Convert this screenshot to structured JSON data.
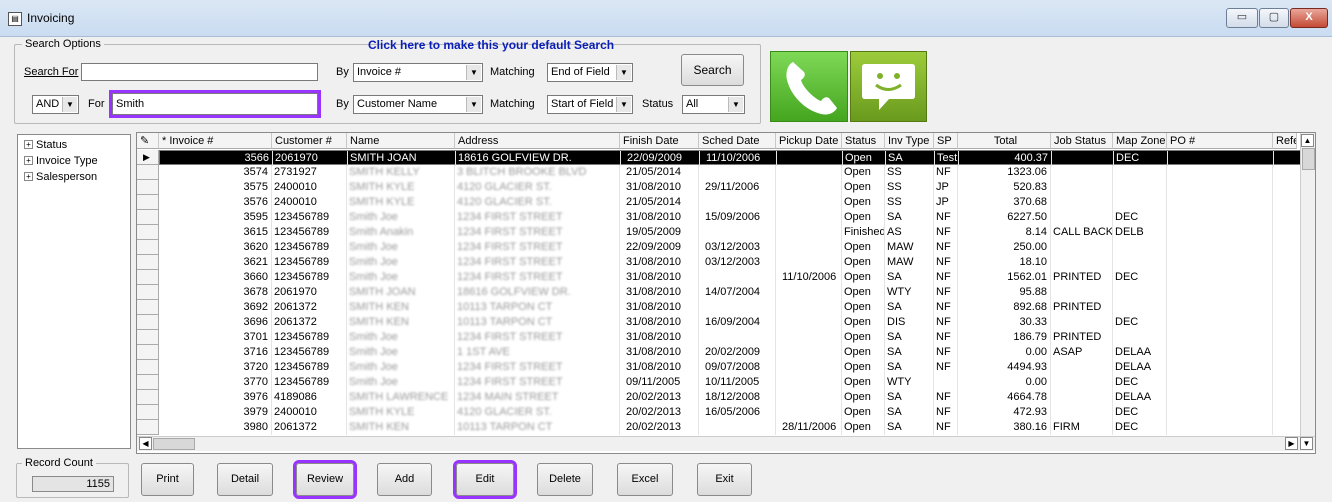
{
  "window": {
    "title": "Invoicing",
    "min": "▭",
    "max": "▢",
    "close": "X"
  },
  "search": {
    "group_label": "Search Options",
    "default_link": "Click here to make this your default Search",
    "search_for_label": "Search For",
    "search_for_value": "",
    "by_label": "By",
    "by1_value": "Invoice #",
    "matching_label": "Matching",
    "match1_value": "End of Field",
    "search_button": "Search",
    "and_value": "AND",
    "for_label": "For",
    "for_value": "Smith",
    "by2_value": "Customer Name",
    "match2_value": "Start of Field",
    "status_label": "Status",
    "status_value": "All"
  },
  "icons": {
    "phone": "phone-icon",
    "sms": "sms-icon",
    "green": "#5cb82e",
    "sms_green": "#7fb12a"
  },
  "tree": [
    "Status",
    "Invoice Type",
    "Salesperson"
  ],
  "grid": {
    "headers": [
      "* Invoice #",
      "Customer #",
      "Name",
      "Address",
      "Finish Date",
      "Sched Date",
      "Pickup Date",
      "Status",
      "Inv Type",
      "SP",
      "Total",
      "Job Status",
      "Map Zone",
      "PO #",
      "Refe"
    ],
    "rows": [
      [
        "3566",
        "2061970",
        "SMITH JOAN",
        "18616 GOLFVIEW DR.",
        "22/09/2009",
        "11/10/2006",
        "",
        "Open",
        "SA",
        "Test",
        "400.37",
        "",
        "DEC",
        ""
      ],
      [
        "3574",
        "2731927",
        "SMITH KELLY",
        "3 BLITCH BROOKE BLVD",
        "21/05/2014",
        "",
        "",
        "Open",
        "SS",
        "NF",
        "1323.06",
        "",
        "",
        ""
      ],
      [
        "3575",
        "2400010",
        "SMITH KYLE",
        "4120 GLACIER ST.",
        "31/08/2010",
        "29/11/2006",
        "",
        "Open",
        "SS",
        "JP",
        "520.83",
        "",
        "",
        ""
      ],
      [
        "3576",
        "2400010",
        "SMITH KYLE",
        "4120 GLACIER ST.",
        "21/05/2014",
        "",
        "",
        "Open",
        "SS",
        "JP",
        "370.68",
        "",
        "",
        ""
      ],
      [
        "3595",
        "123456789",
        "Smith Joe",
        "1234 FIRST STREET",
        "31/08/2010",
        "15/09/2006",
        "",
        "Open",
        "SA",
        "NF",
        "6227.50",
        "",
        "DEC",
        ""
      ],
      [
        "3615",
        "123456789",
        "Smith Anakin",
        "1234 FIRST STREET",
        "19/05/2009",
        "",
        "",
        "Finished",
        "AS",
        "NF",
        "8.14",
        "CALL BACK",
        "DELB",
        ""
      ],
      [
        "3620",
        "123456789",
        "Smith Joe",
        "1234 FIRST STREET",
        "22/09/2009",
        "03/12/2003",
        "",
        "Open",
        "MAW",
        "NF",
        "250.00",
        "",
        "",
        ""
      ],
      [
        "3621",
        "123456789",
        "Smith Joe",
        "1234 FIRST STREET",
        "31/08/2010",
        "03/12/2003",
        "",
        "Open",
        "MAW",
        "NF",
        "18.10",
        "",
        "",
        ""
      ],
      [
        "3660",
        "123456789",
        "Smith Joe",
        "1234 FIRST STREET",
        "31/08/2010",
        "",
        "11/10/2006",
        "Open",
        "SA",
        "NF",
        "1562.01",
        "PRINTED",
        "DEC",
        ""
      ],
      [
        "3678",
        "2061970",
        "SMITH JOAN",
        "18616 GOLFVIEW DR.",
        "31/08/2010",
        "14/07/2004",
        "",
        "Open",
        "WTY",
        "NF",
        "95.88",
        "",
        "",
        ""
      ],
      [
        "3692",
        "2061372",
        "SMITH KEN",
        "10113 TARPON CT",
        "31/08/2010",
        "",
        "",
        "Open",
        "SA",
        "NF",
        "892.68",
        "PRINTED",
        "",
        ""
      ],
      [
        "3696",
        "2061372",
        "SMITH KEN",
        "10113 TARPON CT",
        "31/08/2010",
        "16/09/2004",
        "",
        "Open",
        "DIS",
        "NF",
        "30.33",
        "",
        "DEC",
        ""
      ],
      [
        "3701",
        "123456789",
        "Smith Joe",
        "1234 FIRST STREET",
        "31/08/2010",
        "",
        "",
        "Open",
        "SA",
        "NF",
        "186.79",
        "PRINTED",
        "",
        ""
      ],
      [
        "3716",
        "123456789",
        "Smith Joe",
        "1 1ST AVE",
        "31/08/2010",
        "20/02/2009",
        "",
        "Open",
        "SA",
        "NF",
        "0.00",
        "ASAP",
        "DELAA",
        ""
      ],
      [
        "3720",
        "123456789",
        "Smith Joe",
        "1234 FIRST STREET",
        "31/08/2010",
        "09/07/2008",
        "",
        "Open",
        "SA",
        "NF",
        "4494.93",
        "",
        "DELAA",
        ""
      ],
      [
        "3770",
        "123456789",
        "Smith Joe",
        "1234 FIRST STREET",
        "09/11/2005",
        "10/11/2005",
        "",
        "Open",
        "WTY",
        "",
        "0.00",
        "",
        "DEC",
        ""
      ],
      [
        "3976",
        "4189086",
        "SMITH LAWRENCE",
        "1234 MAIN STREET",
        "20/02/2013",
        "18/12/2008",
        "",
        "Open",
        "SA",
        "NF",
        "4664.78",
        "",
        "DELAA",
        ""
      ],
      [
        "3979",
        "2400010",
        "SMITH KYLE",
        "4120 GLACIER ST.",
        "20/02/2013",
        "16/05/2006",
        "",
        "Open",
        "SA",
        "NF",
        "472.93",
        "",
        "DEC",
        ""
      ],
      [
        "3980",
        "2061372",
        "SMITH KEN",
        "10113 TARPON CT",
        "20/02/2013",
        "",
        "28/11/2006",
        "Open",
        "SA",
        "NF",
        "380.16",
        "FIRM",
        "DEC",
        ""
      ]
    ]
  },
  "record_count": {
    "label": "Record Count",
    "value": "1155"
  },
  "buttons": {
    "print": "Print",
    "detail": "Detail",
    "review": "Review",
    "add": "Add",
    "edit": "Edit",
    "delete": "Delete",
    "excel": "Excel",
    "exit": "Exit"
  }
}
